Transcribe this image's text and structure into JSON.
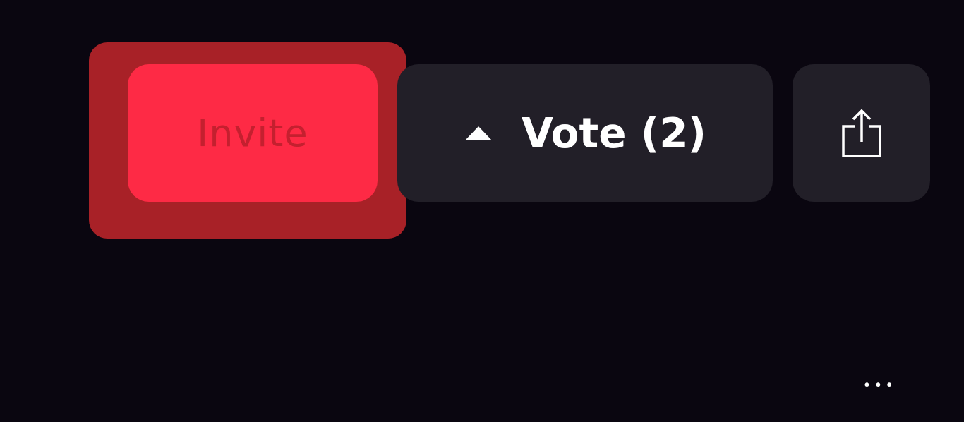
{
  "actions": [
    {
      "kind": "invite",
      "label": "Invite",
      "highlighted": true
    },
    {
      "kind": "vote",
      "label": "Vote (2)",
      "highlighted": false
    },
    {
      "kind": "share",
      "highlighted": false
    }
  ],
  "more": {
    "label": "•••"
  }
}
